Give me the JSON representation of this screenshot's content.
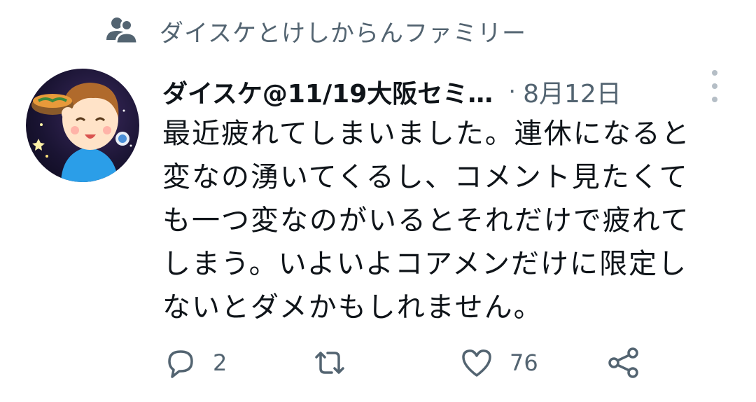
{
  "social_context": {
    "text": "ダイスケとけしからんファミリー",
    "icon": "people-icon"
  },
  "tweet": {
    "author_name": "ダイスケ@11/19大阪セミ…",
    "separator": "·",
    "date": "8月12日",
    "text_lines": [
      "最近疲れてしまいました。連休になると",
      "変なの湧いてくるし、コメント見たくて",
      "も一つ変なのがいるとそれだけで疲れて",
      "しまう。いよいよコアメンだけに限定し",
      "ないとダメかもしれません。"
    ],
    "actions": {
      "reply_count": "2",
      "retweet_count": "",
      "like_count": "76"
    }
  },
  "colors": {
    "text_primary": "#0f1419",
    "text_secondary": "#536471",
    "icon_gray": "#536471"
  }
}
